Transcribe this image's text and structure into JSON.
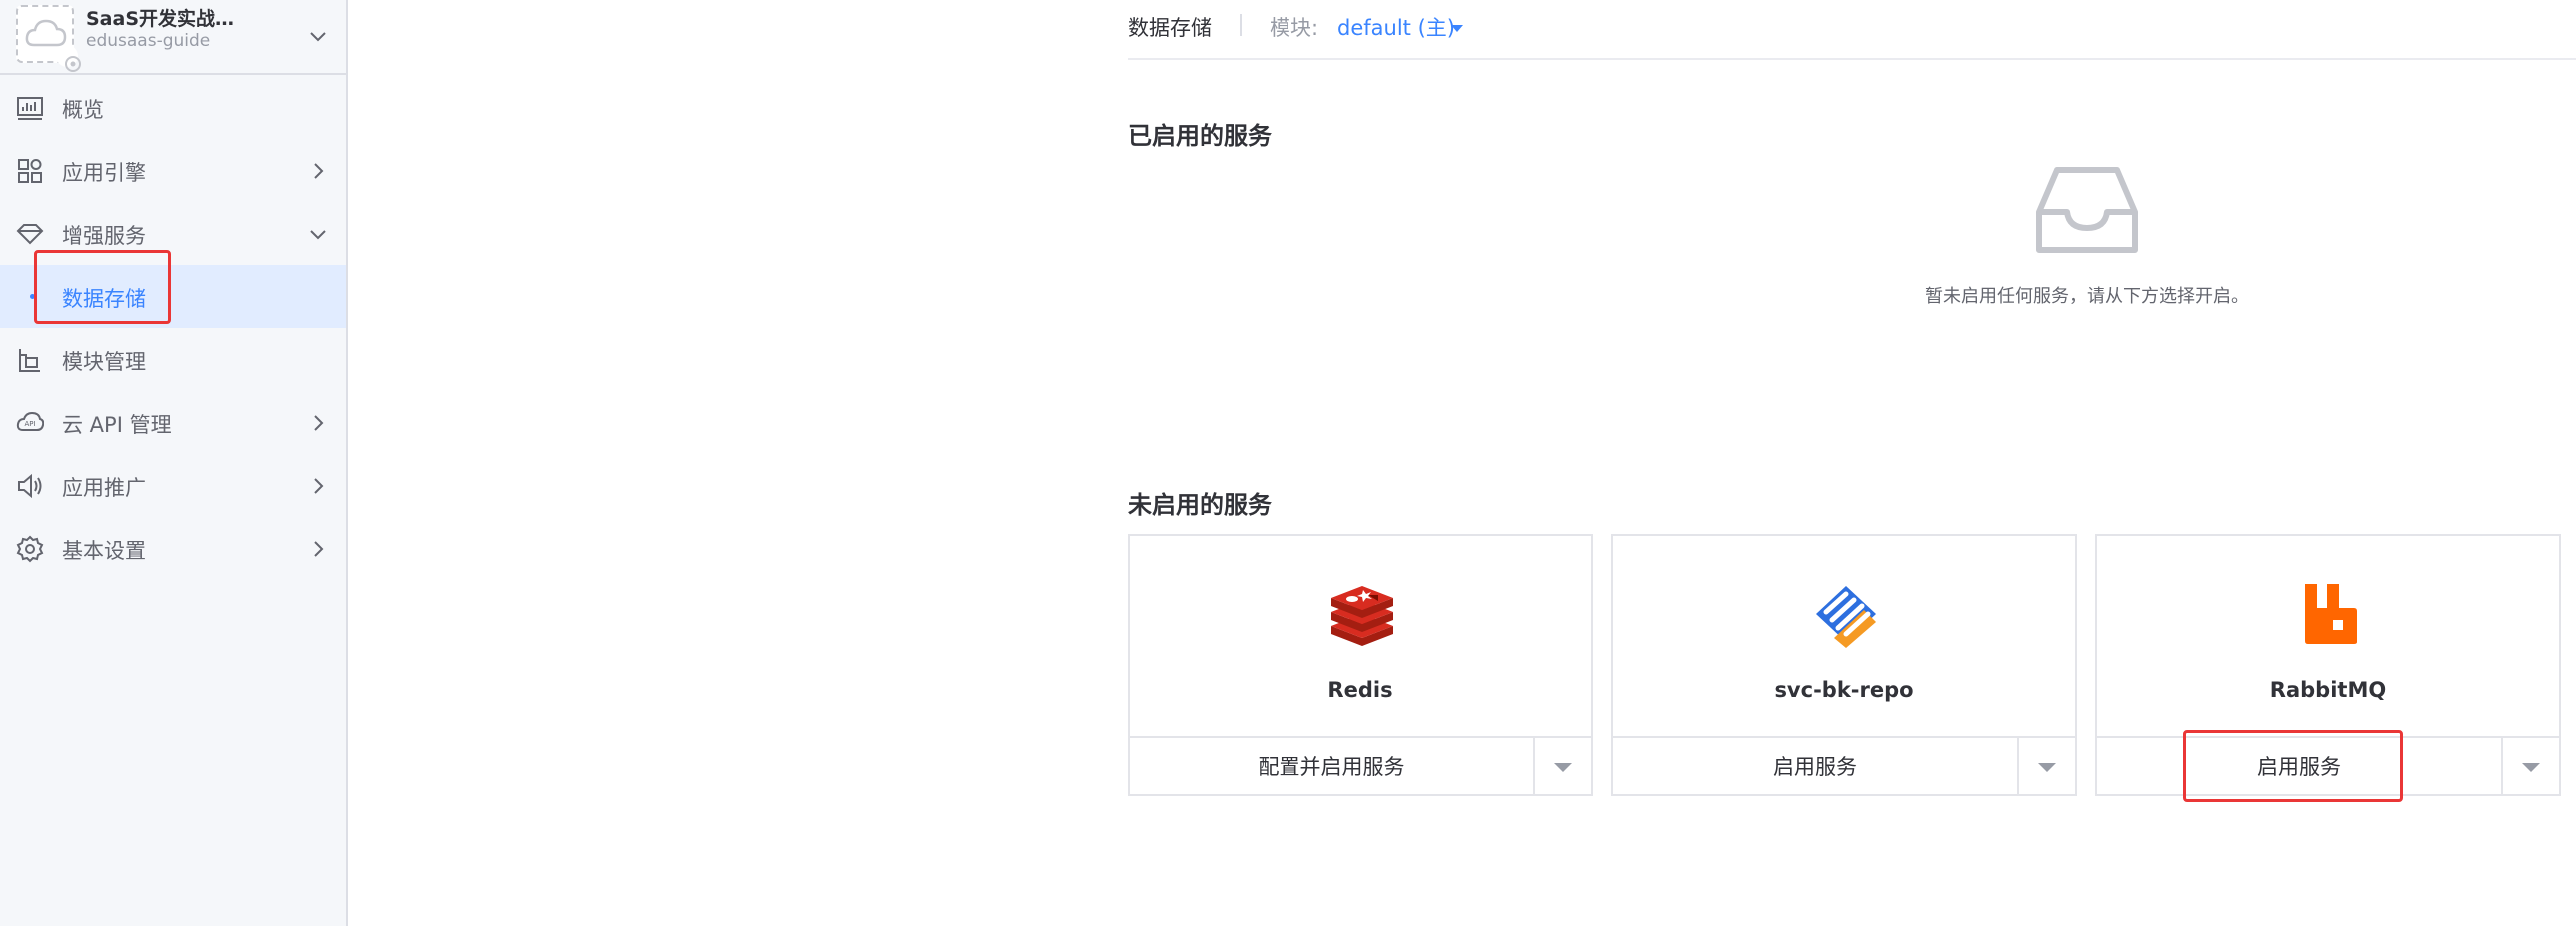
{
  "app": {
    "name": "SaaS开发实战…",
    "code": "edusaas-guide",
    "logo_icon": "cloud-icon",
    "switch_icon": "chevron-down-icon"
  },
  "sidebar": {
    "items": [
      {
        "label": "概览",
        "icon": "overview-icon",
        "arrow": ""
      },
      {
        "label": "应用引擎",
        "icon": "app-engine-icon",
        "arrow": "chevron-right-icon"
      },
      {
        "label": "增强服务",
        "icon": "diamond-icon",
        "arrow": "chevron-down-icon"
      },
      {
        "label": "数据存储",
        "icon": "",
        "arrow": "",
        "active": true
      },
      {
        "label": "模块管理",
        "icon": "module-icon",
        "arrow": ""
      },
      {
        "label": "云 API 管理",
        "icon": "api-icon",
        "arrow": "chevron-right-icon"
      },
      {
        "label": "应用推广",
        "icon": "speaker-icon",
        "arrow": "chevron-right-icon"
      },
      {
        "label": "基本设置",
        "icon": "gear-icon",
        "arrow": "chevron-right-icon"
      }
    ]
  },
  "header": {
    "title": "数据存储",
    "module_label": "模块:",
    "module_value": "default (主)"
  },
  "enabled_section": {
    "title": "已启用的服务",
    "empty_text": "暂未启用任何服务，请从下方选择开启。",
    "empty_icon": "inbox-icon"
  },
  "disabled_section": {
    "title": "未启用的服务",
    "services": [
      {
        "name": "Redis",
        "button": "配置并启用服务",
        "icon": "redis-icon"
      },
      {
        "name": "svc-bk-repo",
        "button": "启用服务",
        "icon": "bk-repo-icon"
      },
      {
        "name": "RabbitMQ",
        "button": "启用服务",
        "icon": "rabbitmq-icon"
      }
    ]
  },
  "colors": {
    "accent": "#3a84ff",
    "highlight": "#ea3636",
    "redis": "#d82c20",
    "bk_repo_blue": "#2d6fdf",
    "bk_repo_orange": "#f59a23",
    "rabbitmq": "#ff6600"
  }
}
